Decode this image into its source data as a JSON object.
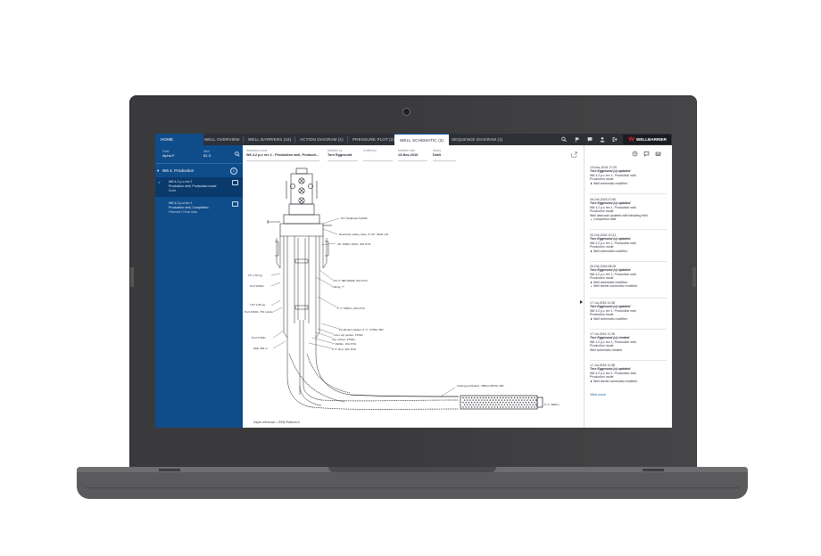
{
  "tabs": {
    "home": "HOME",
    "well_overview": "WELL OVERVIEW",
    "well_barriers": "WELL BARRIERS (16)",
    "action_diagram": "ACTION DIAGRAM (1)",
    "pressure_plot": "PRESSURE PLOT (2)",
    "well_schematic": "WELL SCHEMATIC (2)",
    "sequence_diagram": "SEQUENCE DIAGRAM (1)"
  },
  "brand": {
    "name": "WELLBARRIER",
    "color": "#d0202a"
  },
  "sidebar": {
    "field_label": "Field",
    "field_value": "Alpha-P",
    "well_label": "Well",
    "well_value": "B1-S",
    "group_title": "W6 4. Production",
    "group_count": "2",
    "items": [
      {
        "line1": "W6 4.2 p-c rev 1",
        "line2": "Production well, Production mode",
        "line3": "Draft",
        "selected": true
      },
      {
        "line1": "W6 4.2 p-d rev 1",
        "line2": "Production well, Completion",
        "line3": "Planned | Final data",
        "selected": false
      }
    ]
  },
  "header": {
    "name_label": "Illustration name",
    "name_value": "W6 4.2 p-c rev 1 - Production well, Producti...",
    "modified_by_label": "Modified by",
    "modified_by_value": "Tore Eggesund",
    "verified_by_label": "Verified by",
    "verified_by_value": "",
    "modified_date_label": "Modified date",
    "modified_date_value": "13-Nov-2016",
    "status_label": "Status",
    "status_value": "Draft"
  },
  "diagram_labels": {
    "a": "8½\" Wellhead 5,000#",
    "b": "Downhole safety valve, 8 1/2\", 8044 mD",
    "c": "26\" 1500m WOC, WG PVS",
    "d": "16 ⅝\" 980,5000#, WG PVS",
    "e": "Tubing, 7\"",
    "f": "9 ⅞\" 5000m, WG PVS",
    "g": "Production packer, 9 ⅞\", 2750m MD",
    "h": "Liner top packer, 2750m",
    "i": "Top of liner, 2750m",
    "j": "7\" 4900m, WG PVS",
    "k": "5 ½\" liner, WG PVS",
    "l": "Casing perforation, 3800m-5870m MD",
    "m": "FIT 1.50 sg",
    "n": "Perf 1000m",
    "o": "LOT 1.80 sg",
    "p": "Perf 1000m, 5% return",
    "q": "Perf 1700m",
    "r": "PDF 300 m",
    "s": "8 ⅞\" 4900m"
  },
  "depth_reference": "Depth reference = RKB Platform A",
  "activity": {
    "entries": [
      {
        "date": "13-Nov-2016 17:20",
        "user": "Tore Eggesund (u) updated",
        "title": "W6 4.2 p-c rev 1, Production well,",
        "subtitle": "Production mode",
        "bullets": [
          "Well schematic modified"
        ]
      },
      {
        "date": "26-Oct-2016 07:50",
        "user": "Tore Eggesund (u) updated",
        "title": "W6 4.2 p-c rev 1, Production well,",
        "subtitle": "Production mode",
        "extra": "Well data was updated with following field",
        "bullets": [
          "Completion date"
        ]
      },
      {
        "date": "20-Oct-2016 10:31",
        "user": "Tore Eggesund (u) updated",
        "title": "W6 4.2 p-c rev 1, Production well,",
        "subtitle": "Production mode",
        "bullets": [
          "Well schematic modified"
        ]
      },
      {
        "date": "20-Oct-2016 08:25",
        "user": "Tore Eggesund (u) updated",
        "title": "W6 4.2 p-c rev 1, Production well,",
        "subtitle": "Production mode",
        "bullets": [
          "Well schematic modified",
          "Well barrier schematic modified"
        ]
      },
      {
        "date": "17-Jul-2016 11:38",
        "user": "Tore Eggesund (u) updated",
        "title": "W6 4.2 p-c rev 1, Production well,",
        "subtitle": "Production mode",
        "bullets": [
          "Well schematic modified"
        ]
      },
      {
        "date": "17-Jul-2016 11:39",
        "user": "Tore Eggesund (u) created",
        "title": "W6 4.2 p-c rev 1, Production well,",
        "subtitle": "Production mode",
        "extra": "Well schematic created",
        "bullets": []
      },
      {
        "date": "17-Jul-2016 11:38",
        "user": "Tore Eggesund (u) updated",
        "title": "W6 4.2 p-c rev 1, Production well,",
        "subtitle": "Production mode",
        "bullets": [
          "Well barrier schematic modified"
        ]
      }
    ],
    "view_more": "View more"
  }
}
